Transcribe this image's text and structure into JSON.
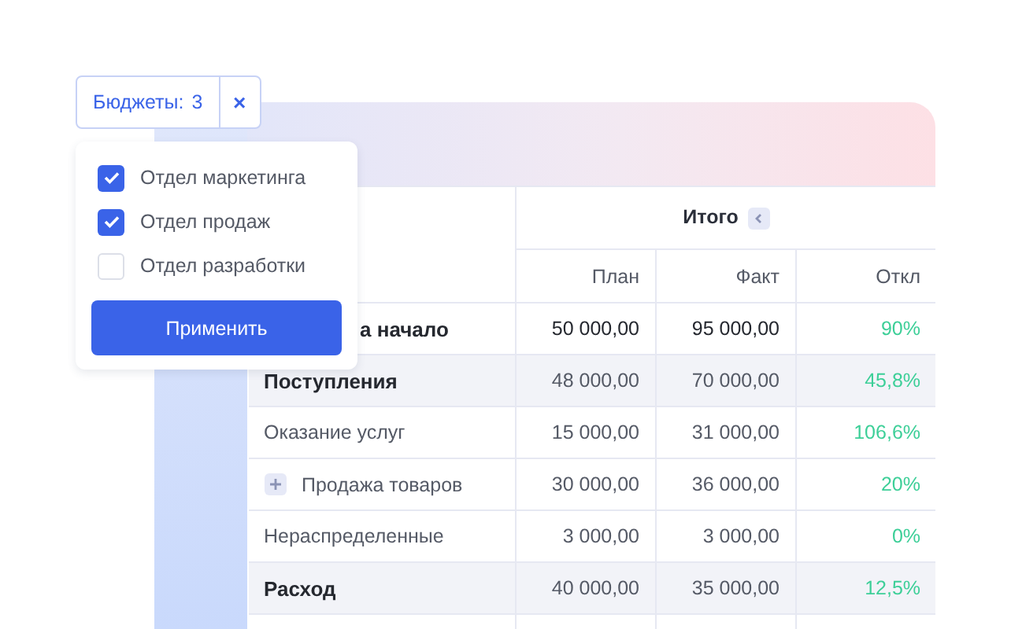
{
  "filter": {
    "label": "Бюджеты:",
    "count": "3",
    "clear": "×"
  },
  "dropdown": {
    "options": [
      {
        "label": "Отдел маркетинга",
        "checked": true
      },
      {
        "label": "Отдел продаж",
        "checked": true
      },
      {
        "label": "Отдел разработки",
        "checked": false
      }
    ],
    "apply": "Применить"
  },
  "table": {
    "group_header": "Итого",
    "group_collapsed": false,
    "columns": [
      "План",
      "Факт",
      "Откл"
    ],
    "rows": [
      {
        "kind": "opening",
        "label": "а начало",
        "expandable": false,
        "cells": [
          "50 000,00",
          "95 000,00",
          "90%"
        ]
      },
      {
        "kind": "section",
        "label": "Поступления",
        "expandable": false,
        "cells": [
          "48 000,00",
          "70 000,00",
          "45,8%"
        ]
      },
      {
        "kind": "item",
        "label": "Оказание услуг",
        "expandable": false,
        "cells": [
          "15 000,00",
          "31 000,00",
          "106,6%"
        ]
      },
      {
        "kind": "item",
        "label": "Продажа товаров",
        "expandable": true,
        "cells": [
          "30 000,00",
          "36 000,00",
          "20%"
        ]
      },
      {
        "kind": "item",
        "label": "Нераспределенные",
        "expandable": false,
        "cells": [
          "3 000,00",
          "3 000,00",
          "0%"
        ]
      },
      {
        "kind": "section",
        "label": "Расход",
        "expandable": false,
        "cells": [
          "40 000,00",
          "35 000,00",
          "12,5%"
        ]
      }
    ]
  }
}
